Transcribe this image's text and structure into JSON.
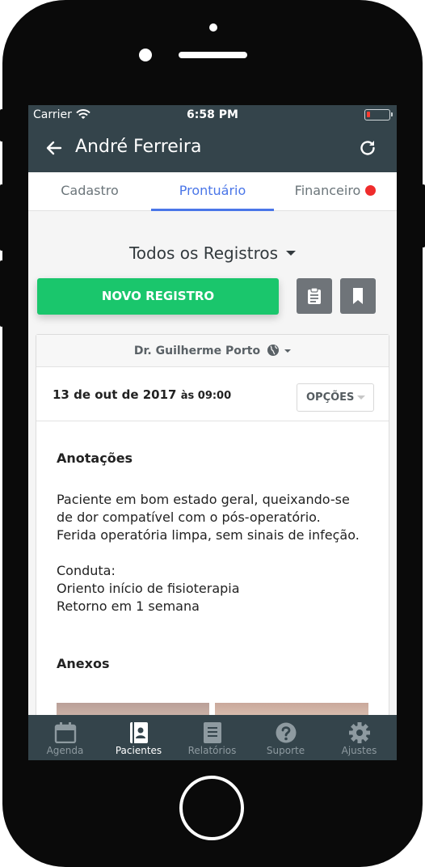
{
  "status": {
    "carrier": "Carrier",
    "time": "6:58 PM"
  },
  "header": {
    "title": "André Ferreira"
  },
  "tabs": [
    {
      "label": "Cadastro"
    },
    {
      "label": "Prontuário",
      "active": true
    },
    {
      "label": "Financeiro",
      "alert": true
    }
  ],
  "filter": {
    "label": "Todos os Registros"
  },
  "actions": {
    "new_record": "NOVO REGISTRO"
  },
  "record": {
    "doctor": "Dr. Guilherme Porto",
    "date": "13 de out de 2017",
    "time": "às 09:00",
    "options_label": "OPÇÕES",
    "notes_title": "Anotações",
    "notes_lines": [
      "Paciente em bom estado geral, queixando-se",
      "de dor compatível com o pós-operatório.",
      "Ferida operatória limpa, sem sinais de infeção.",
      "",
      "Conduta:",
      "Oriento início de fisioterapia",
      "Retorno em 1 semana"
    ],
    "annexes_title": "Anexos"
  },
  "tabbar": [
    {
      "label": "Agenda",
      "icon": "calendar-icon"
    },
    {
      "label": "Pacientes",
      "icon": "contacts-icon",
      "active": true
    },
    {
      "label": "Relatórios",
      "icon": "report-icon"
    },
    {
      "label": "Suporte",
      "icon": "help-icon"
    },
    {
      "label": "Ajustes",
      "icon": "gear-icon"
    }
  ],
  "colors": {
    "primary_dark": "#34444b",
    "accent_blue": "#4a76e8",
    "success_green": "#1ac66c",
    "alert_red": "#ef2c2c"
  }
}
